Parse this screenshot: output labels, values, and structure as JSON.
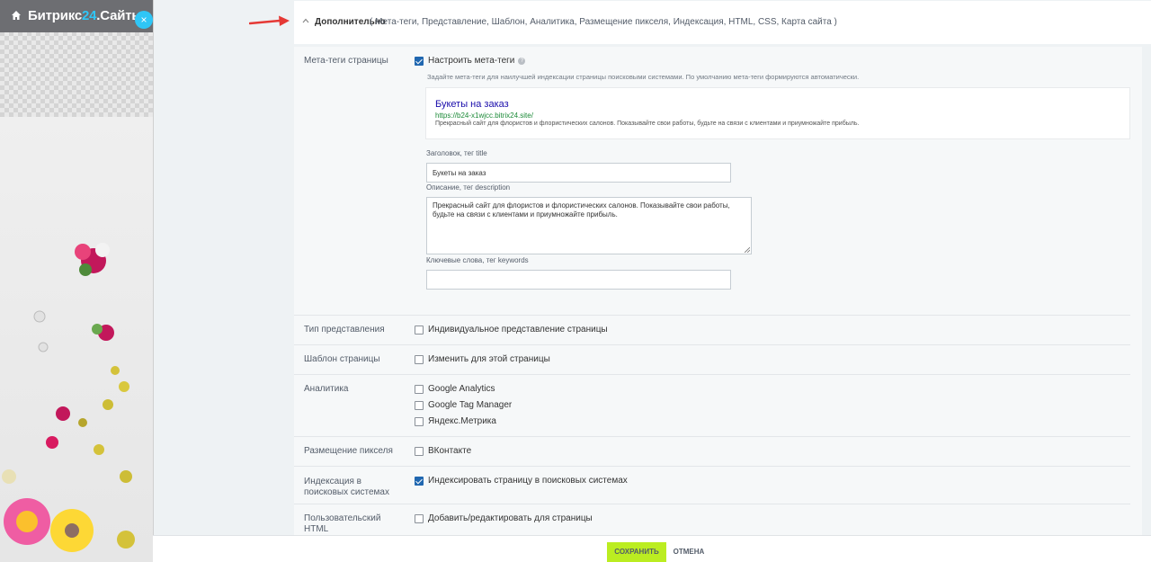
{
  "app": {
    "logo_part1": "Битрикс",
    "logo_part2": "24",
    "logo_part3": ".Сайты",
    "close_glyph": "×"
  },
  "section": {
    "title": "Дополнительно",
    "subtitle": "( Мета-теги,  Представление,  Шаблон,  Аналитика,  Размещение пикселя,  Индексация,  HTML,  CSS,  Карта сайта )"
  },
  "meta": {
    "row_label": "Мета-теги страницы",
    "checkbox_label": "Настроить мета-теги",
    "checked": true,
    "hint": "Задайте мета-теги для наилучшей индексации страницы поисковыми системами. По умолчанию мета-теги формируются автоматически.",
    "preview": {
      "title": "Букеты на заказ",
      "url": "https://b24-x1wjcc.bitrix24.site/",
      "description": "Прекрасный сайт для флористов и флористических салонов. Показывайте свои работы, будьте на связи с клиентами и приумножайте прибыль."
    },
    "title_label": "Заголовок, тег title",
    "title_value": "Букеты на заказ",
    "description_label": "Описание, тег description",
    "description_value": "Прекрасный сайт для флористов и флористических салонов. Показывайте свои работы, будьте на связи с клиентами и приумножайте прибыль.",
    "keywords_label": "Ключевые слова, тег keywords",
    "keywords_value": ""
  },
  "rows": {
    "view": {
      "label": "Тип представления",
      "option": "Индивидуальное представление страницы",
      "checked": false
    },
    "template": {
      "label": "Шаблон страницы",
      "option": "Изменить для этой страницы",
      "checked": false
    },
    "analytics": {
      "label": "Аналитика",
      "options": [
        "Google Analytics",
        "Google Tag Manager",
        "Яндекс.Метрика"
      ]
    },
    "pixel": {
      "label": "Размещение пикселя",
      "option": "ВКонтакте",
      "checked": false
    },
    "indexing": {
      "label": "Индексация в поисковых системах",
      "option": "Индексировать страницу в поисковых системах",
      "checked": true
    },
    "html": {
      "label": "Пользовательский HTML",
      "option": "Добавить/редактировать для страницы",
      "checked": false
    }
  },
  "footer": {
    "save_label": "СОХРАНИТЬ",
    "cancel_label": "ОТМЕНА"
  },
  "colors": {
    "accent": "#2fc6f6",
    "save_button": "#bbed21",
    "checkbox_checked": "#2067b0",
    "arrow": "#e53935"
  },
  "icons": [
    "home-icon",
    "close-icon",
    "chevron-up-icon",
    "help-icon",
    "resize-handle-icon"
  ]
}
